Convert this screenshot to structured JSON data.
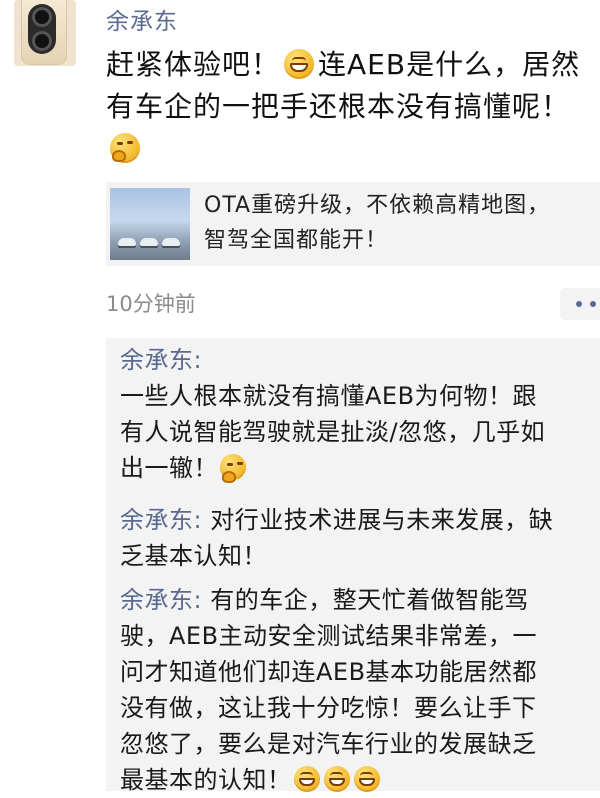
{
  "post": {
    "author": "余承东",
    "text_line1": "赶紧体验吧！",
    "text_line1b": "连AEB是什么，居然",
    "text_line2": "有车企的一把手还根本没有搞懂呢！",
    "emoji_after_line1": "grin-emoji",
    "emoji_line3": "thinking-emoji"
  },
  "link": {
    "line1": "OTA重磅升级，不依赖高精地图，",
    "line2": "智驾全国都能开！"
  },
  "meta": {
    "time": "10分钟前"
  },
  "comments": [
    {
      "author": "余承东:",
      "lines": [
        "一些人根本就没有搞懂AEB为何物！跟",
        "有人说智能驾驶就是扯淡/忽悠，几乎如",
        "出一辙！"
      ]
    },
    {
      "author": "余承东:",
      "lines": [
        "对行业技术进展与未来发展，缺",
        "乏基本认知！"
      ]
    },
    {
      "author": "余承东:",
      "lines": [
        "有的车企，整天忙着做智能驾",
        "驶，AEB主动安全测试结果非常差，一",
        "问才知道他们却连AEB基本功能居然都",
        "没有做，这让我十分吃惊！要么让手下",
        "忽悠了，要么是对汽车行业的发展缺乏",
        "最基本的认知！"
      ]
    }
  ],
  "colors": {
    "name_blue": "#5a6a90",
    "card_bg": "#f3f3f3",
    "time_gray": "#8b8b8b"
  }
}
